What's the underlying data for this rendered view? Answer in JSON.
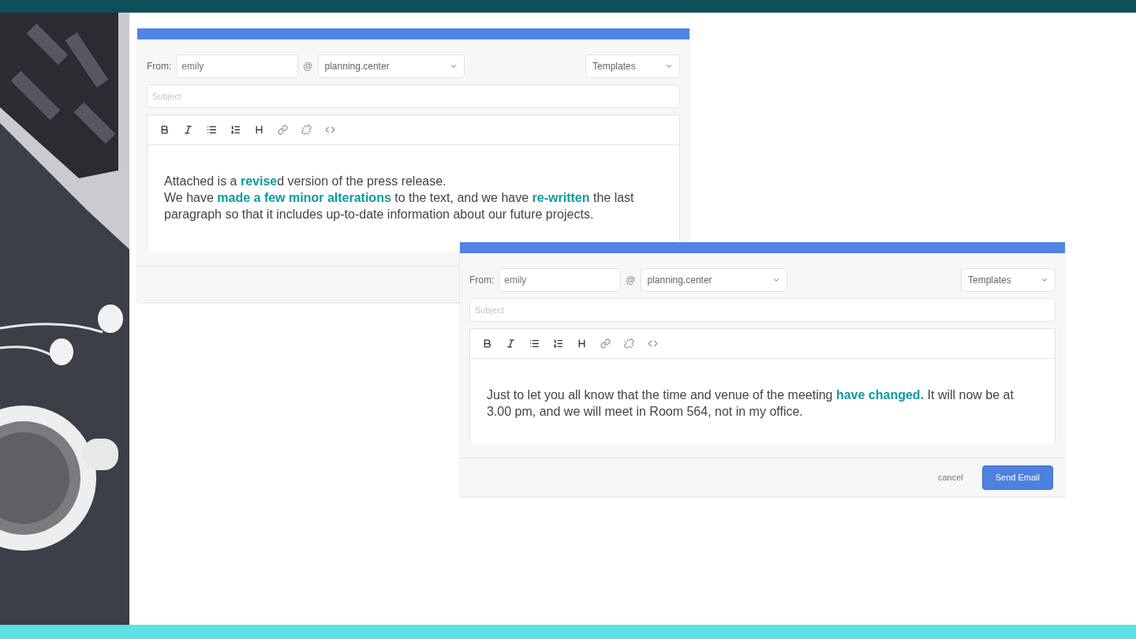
{
  "windows": [
    {
      "from_label": "From:",
      "from_value": "emily",
      "at_sign": "@",
      "domain": "planning.center",
      "templates": "Templates",
      "subject_placeholder": "Subject",
      "body": [
        "Attached is a **revise**d version of the press release.",
        "We have **made a few minor alterations** to the text, and we have **re-written** the last paragraph so  that it includes up-to-date information about our future projects."
      ]
    },
    {
      "from_label": "From:",
      "from_value": "emily",
      "at_sign": "@",
      "domain": "planning.center",
      "templates": "Templates",
      "subject_placeholder": "Subject",
      "body": [
        "Just to let you all know that the time and venue of the meeting **have changed.** It will now be at 3.00 pm, and we will meet in Room 564, not in my office."
      ],
      "buttons": [
        {
          "label": "cancel",
          "kind": "link"
        },
        {
          "label": "Send Email",
          "kind": "primary"
        }
      ]
    }
  ]
}
